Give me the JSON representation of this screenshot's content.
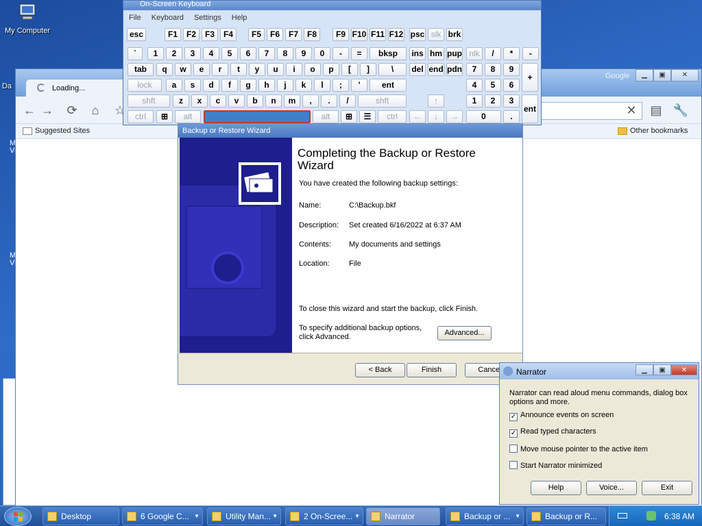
{
  "desktop": {
    "icons": [
      {
        "label": "My Computer"
      }
    ],
    "partial_labels": [
      "Da",
      "M",
      "Vi",
      "M",
      "Vi"
    ]
  },
  "chrome": {
    "tab_label": "Loading...",
    "google_label": "Google",
    "bookmarks": {
      "suggested": "Suggested Sites",
      "other": "Other bookmarks"
    }
  },
  "osk": {
    "title": "On-Screen Keyboard",
    "menu": [
      "File",
      "Keyboard",
      "Settings",
      "Help"
    ]
  },
  "wizard": {
    "title": "Backup or Restore Wizard",
    "heading": "Completing the Backup or Restore Wizard",
    "intro": "You have created the following backup settings:",
    "fields": [
      {
        "label": "Name:",
        "value": "C:\\Backup.bkf"
      },
      {
        "label": "Description:",
        "value": "Set created 6/16/2022 at 6:37 AM"
      },
      {
        "label": "Contents:",
        "value": "My documents and settings"
      },
      {
        "label": "Location:",
        "value": "File"
      }
    ],
    "close_text": "To close this wizard and start the backup, click Finish.",
    "advanced_text": "To specify additional backup options, click Advanced.",
    "buttons": {
      "advanced": "Advanced...",
      "back": "< Back",
      "finish": "Finish",
      "cancel": "Cancel"
    }
  },
  "narrator": {
    "title": "Narrator",
    "description": "Narrator can read aloud menu commands, dialog box options and more.",
    "options": [
      {
        "label": "Announce events on screen",
        "checked": true
      },
      {
        "label": "Read typed characters",
        "checked": true
      },
      {
        "label": "Move mouse pointer to the active item",
        "checked": false
      },
      {
        "label": "Start Narrator minimized",
        "checked": false
      }
    ],
    "buttons": {
      "help": "Help",
      "voice": "Voice...",
      "exit": "Exit"
    }
  },
  "taskbar": {
    "items": [
      "Desktop",
      "6 Google C...",
      "Utility Man...",
      "2 On-Scree...",
      "Narrator",
      "Backup or ...",
      "Backup or R..."
    ],
    "clock": "6:38 AM"
  }
}
